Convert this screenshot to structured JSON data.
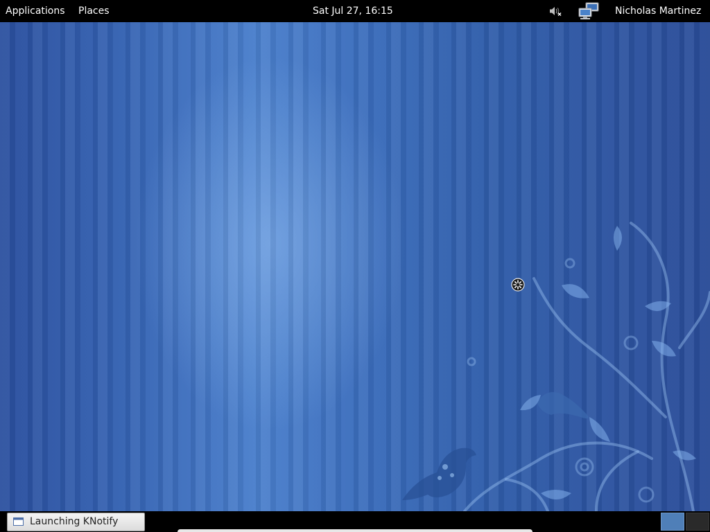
{
  "top_panel": {
    "applications_label": "Applications",
    "places_label": "Places",
    "clock": "Sat Jul 27, 16:15",
    "user_name": "Nicholas Martinez",
    "volume_icon": "volume-muted-icon",
    "network_icon": "network-computers-icon"
  },
  "desktop": {
    "wallpaper": "blue-vertical-stripes-with-birds-and-vines",
    "cursor_icon": "busy-cursor-icon"
  },
  "bottom_panel": {
    "task_label": "Launching KNotify",
    "task_icon": "window-icon",
    "workspace_count": 2,
    "active_workspace": 1
  },
  "colors": {
    "panel_bg": "#000000",
    "panel_text": "#ffffff",
    "desktop_blue": "#3563b3",
    "active_workspace": "#4f7fb8"
  }
}
